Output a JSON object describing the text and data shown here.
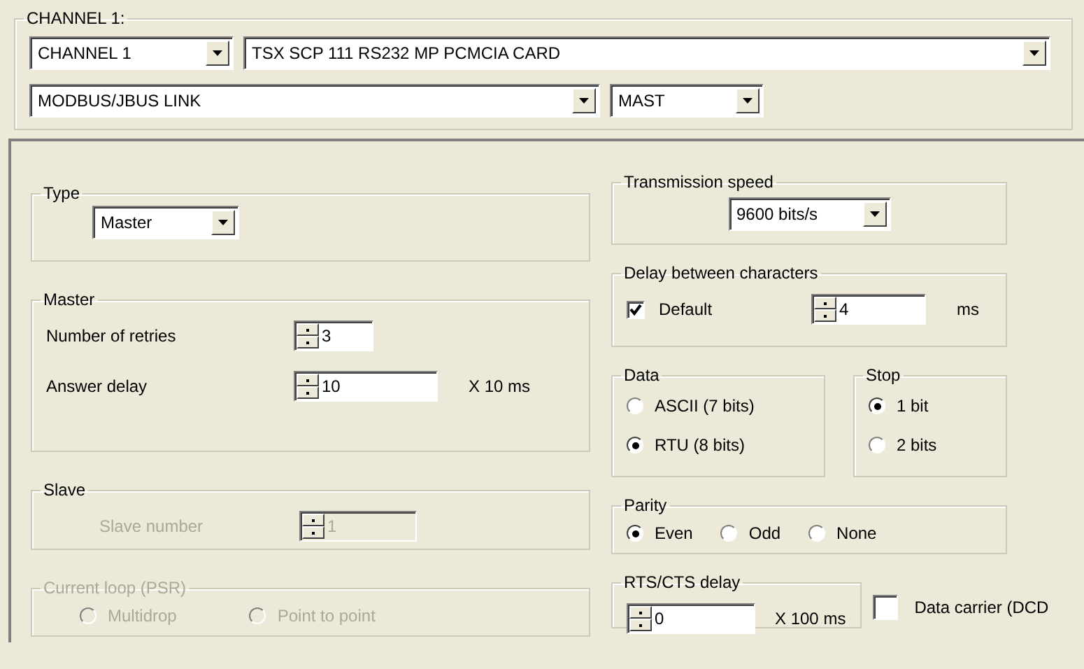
{
  "channel": {
    "title": "CHANNEL 1:",
    "channel_select": "CHANNEL 1",
    "card_select": "TSX SCP 111 RS232 MP PCMCIA CARD",
    "protocol_select": "MODBUS/JBUS LINK",
    "task_select": "MAST"
  },
  "type": {
    "title": "Type",
    "value": "Master"
  },
  "master": {
    "title": "Master",
    "fields": [
      {
        "label": "Number of retries",
        "value": "3",
        "disabled": false
      },
      {
        "label": "Answer delay",
        "value": "10",
        "unit": "X 10 ms",
        "disabled": false
      }
    ]
  },
  "slave": {
    "title": "Slave",
    "fields": [
      {
        "label": "Slave number",
        "value": "1",
        "disabled": true
      }
    ]
  },
  "current_loop": {
    "title": "Current loop (PSR)",
    "disabled": true,
    "options": [
      {
        "label": "Multidrop",
        "selected": false
      },
      {
        "label": "Point to point",
        "selected": false
      }
    ]
  },
  "transmission_speed": {
    "title": "Transmission speed",
    "value": "9600 bits/s"
  },
  "delay": {
    "title": "Delay between characters",
    "default_label": "Default",
    "checked": true,
    "value": "4",
    "unit": "ms"
  },
  "data": {
    "title": "Data",
    "options": [
      {
        "label": "ASCII (7 bits)",
        "selected": false
      },
      {
        "label": "RTU (8 bits)",
        "selected": true
      }
    ]
  },
  "stop": {
    "title": "Stop",
    "options": [
      {
        "label": "1 bit",
        "selected": true
      },
      {
        "label": "2 bits",
        "selected": false
      }
    ]
  },
  "parity": {
    "title": "Parity",
    "options": [
      {
        "label": "Even",
        "selected": true
      },
      {
        "label": "Odd",
        "selected": false
      },
      {
        "label": "None",
        "selected": false
      }
    ]
  },
  "rts_cts": {
    "title": "RTS/CTS delay",
    "value": "0",
    "unit": "X 100 ms"
  },
  "data_carrier": {
    "label": "Data carrier (DCD",
    "checked": false
  }
}
